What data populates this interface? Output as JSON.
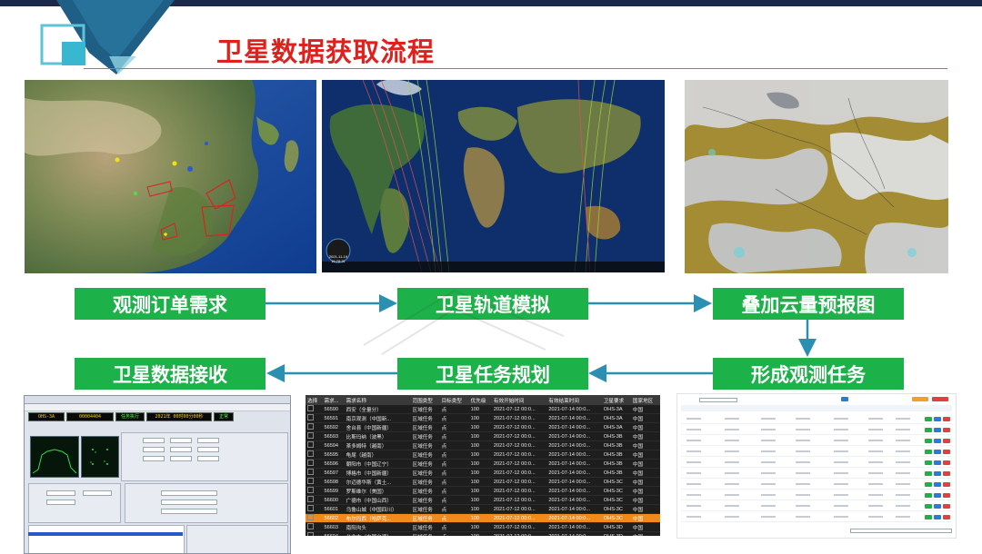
{
  "header": {
    "title": "卫星数据获取流程"
  },
  "flow": {
    "steps": [
      "观测订单需求",
      "卫星轨道模拟",
      "叠加云量预报图",
      "卫星数据接收",
      "卫星任务规划",
      "形成观测任务"
    ]
  },
  "colors": {
    "accent_green": "#1db14a",
    "title_red": "#e0201c",
    "arrow_teal": "#2a8fb0",
    "highlight_orange": "#f08a1c"
  },
  "orbit_panel": {
    "time_date": "2021-11-19",
    "time_clock": "16:28:31"
  },
  "receiver_app": {
    "segments": [
      "OHS-3A",
      "00004404",
      "任务执行",
      "2021年 00时00分00秒",
      "正常"
    ]
  },
  "task_table": {
    "columns": [
      "选择",
      "需求...",
      "需求名称",
      "范围类型",
      "目标类型",
      "优先级",
      "有效开始时间",
      "有效结束时间",
      "卫星要求",
      "国家地区"
    ],
    "rows": [
      [
        "56590",
        "西安（全量分）",
        "区域任务",
        "点",
        "100",
        "2021-07-12 00:0...",
        "2021-07-14 00:0...",
        "OHS-3A",
        "中国"
      ],
      [
        "56591",
        "南京观测（中国新...",
        "区域任务",
        "点",
        "100",
        "2021-07-12 00:0...",
        "2021-07-14 00:0...",
        "OHS-3A",
        "中国"
      ],
      [
        "56592",
        "舍台县（中国新疆）",
        "区域任务",
        "点",
        "100",
        "2021-07-12 00:0...",
        "2021-07-14 00:0...",
        "OHS-3A",
        "中国"
      ],
      [
        "56593",
        "比斯玛纳（波黑）",
        "区域任务",
        "点",
        "100",
        "2021-07-12 00:0...",
        "2021-07-14 00:0...",
        "OHS-3B",
        "中国"
      ],
      [
        "56594",
        "茶多姆特（越南）",
        "区域任务",
        "点",
        "100",
        "2021-07-12 00:0...",
        "2021-07-14 00:0...",
        "OHS-3B",
        "中国"
      ],
      [
        "56595",
        "龟尾（越南）",
        "区域任务",
        "点",
        "100",
        "2021-07-12 00:0...",
        "2021-07-14 00:0...",
        "OHS-3B",
        "中国"
      ],
      [
        "56596",
        "朝阳市（中国辽宁）",
        "区域任务",
        "点",
        "100",
        "2021-07-12 00:0...",
        "2021-07-14 00:0...",
        "OHS-3B",
        "中国"
      ],
      [
        "56597",
        "博格市（中国新疆）",
        "区域任务",
        "点",
        "100",
        "2021-07-12 00:0...",
        "2021-07-14 00:0...",
        "OHS-3B",
        "中国"
      ],
      [
        "56598",
        "尔迈德华斯（黄土...",
        "区域任务",
        "点",
        "100",
        "2021-07-12 00:0...",
        "2021-07-14 00:0...",
        "OHS-3C",
        "中国"
      ],
      [
        "56599",
        "罗斯维尔（美国）",
        "区域任务",
        "点",
        "100",
        "2021-07-12 00:0...",
        "2021-07-14 00:0...",
        "OHS-3C",
        "中国"
      ],
      [
        "56600",
        "广德市（中国山西）",
        "区域任务",
        "点",
        "100",
        "2021-07-12 00:0...",
        "2021-07-14 00:0...",
        "OHS-3C",
        "中国"
      ],
      [
        "56601",
        "乌鲁山城（中国四川）",
        "区域任务",
        "点",
        "100",
        "2021-07-12 00:0...",
        "2021-07-14 00:0...",
        "OHS-3C",
        "中国"
      ],
      [
        "56602",
        "布尔玛西（哈萨克...",
        "区域任务",
        "点",
        "100",
        "2021-07-12 00:0...",
        "2021-07-14 00:0...",
        "OHS-3C",
        "中国"
      ],
      [
        "56603",
        "南阳沟头",
        "区域任务",
        "点",
        "100",
        "2021-07-12 00:0...",
        "2021-07-14 00:0...",
        "OHS-3D",
        "中国"
      ],
      [
        "56604",
        "台北市（中国台湾）",
        "区域任务",
        "点",
        "100",
        "2021-07-12 00:0...",
        "2021-07-14 00:0...",
        "OHS-3D",
        "中国"
      ],
      [
        "56605",
        "巴塘县（中国四川）",
        "区域任务",
        "点",
        "100",
        "2021-07-12 00:0...",
        "2021-07-14 00:0...",
        "OHS-3D",
        "中国"
      ],
      [
        "56606",
        "阿克苏地区（中国...",
        "区域任务",
        "点",
        "100",
        "2021-07-12 00:0...",
        "2021-07-14 00:0...",
        "OHS-3D",
        "中国"
      ]
    ],
    "selected_index": 12
  }
}
